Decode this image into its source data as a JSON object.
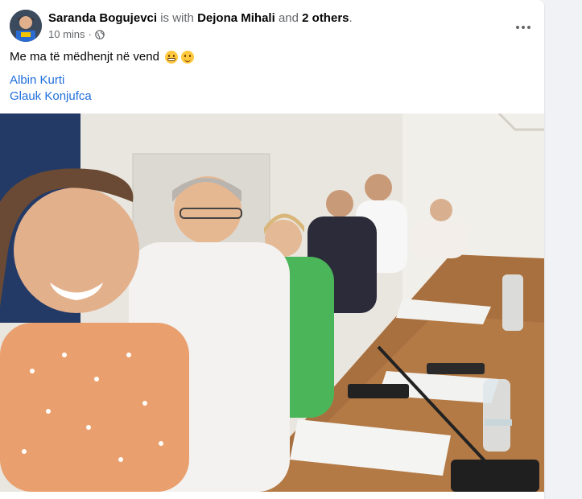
{
  "post": {
    "author": "Saranda Bogujevci",
    "with_text": "is with",
    "tagged_person": "Dejona Mihali",
    "and_text": "and",
    "others": "2 others",
    "period": ".",
    "time": "10 mins",
    "dot": "·",
    "audience_icon": "globe-icon",
    "message": "Me ma të mëdhenjt në vend",
    "emojis": [
      "grinning-face",
      "winking-face"
    ],
    "mentions": [
      "Albin Kurti",
      "Glauk Konjufca"
    ]
  },
  "colors": {
    "link": "#216fdb",
    "text": "#050505",
    "secondary": "#65676b",
    "page_bg": "#f0f2f5"
  }
}
